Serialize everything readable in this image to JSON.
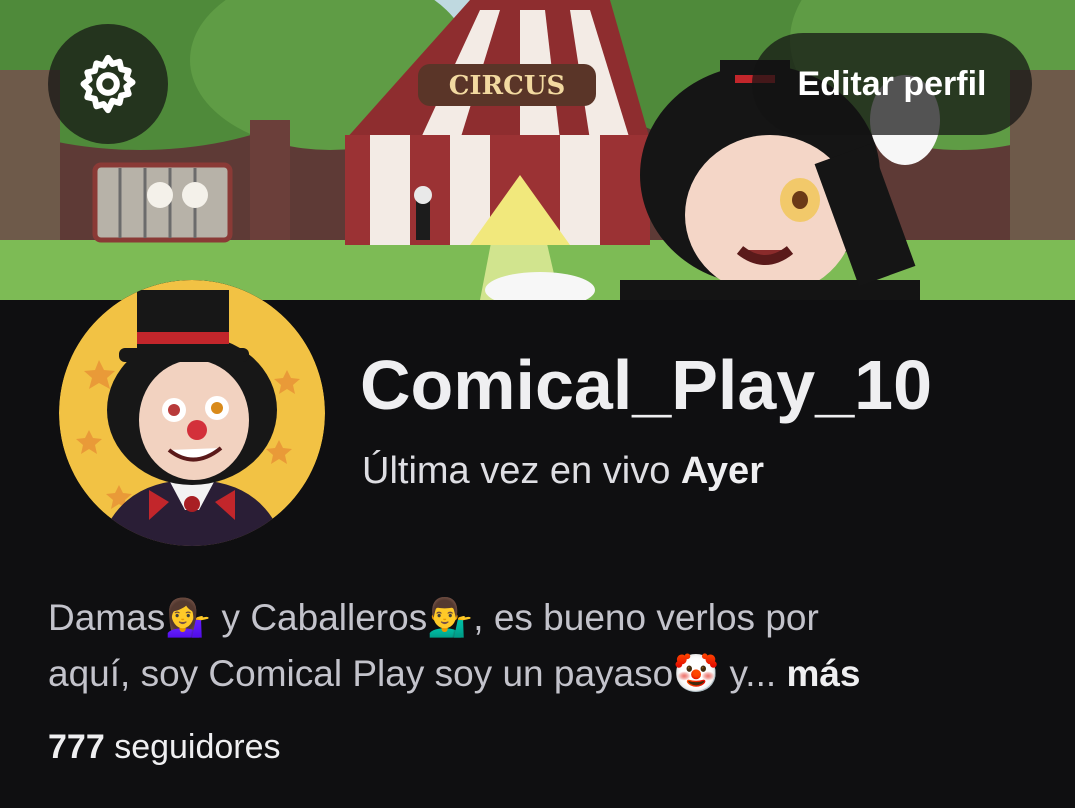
{
  "header": {
    "edit_profile_label": "Editar perfil",
    "settings_icon": "gear-icon",
    "banner_sign_text": "CIRCUS"
  },
  "profile": {
    "username": "Comical_Play_10",
    "last_live_prefix": "Última vez en vivo",
    "last_live_value": "Ayer"
  },
  "bio": {
    "line1": "Damas💁‍♀️ y Caballeros💁‍♂️, es bueno verlos por",
    "line2": "aquí, soy Comical Play soy un payaso🤡 y...",
    "more_label": "más"
  },
  "stats": {
    "followers_count": "777",
    "followers_label": "seguidores"
  },
  "colors": {
    "background": "#0f0f11",
    "text_primary": "#efeff1",
    "text_secondary": "#c3c3cb",
    "overlay_button": "#141414"
  }
}
